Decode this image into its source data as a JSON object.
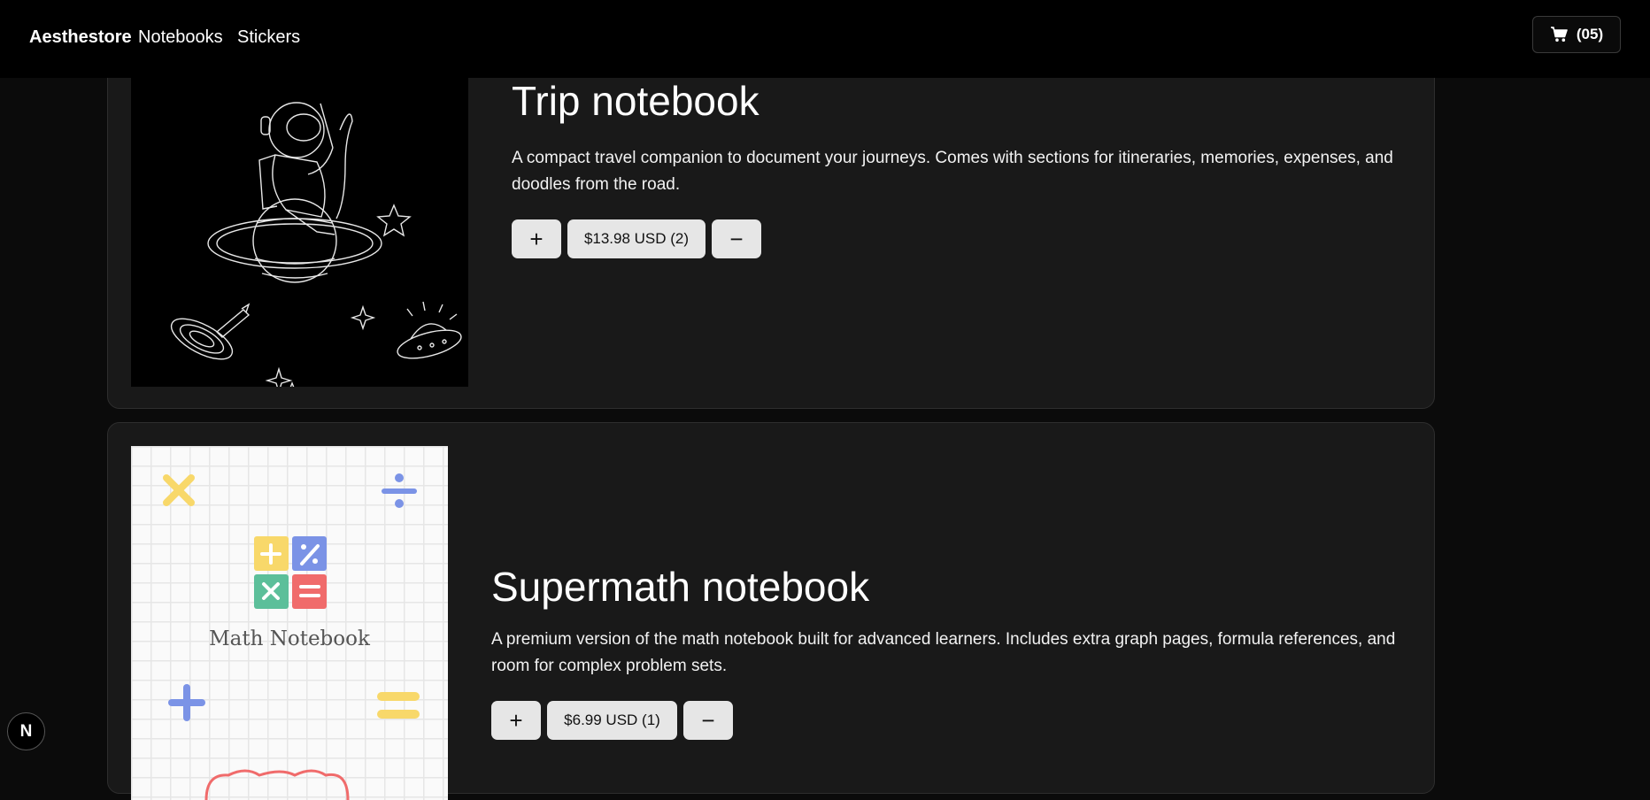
{
  "header": {
    "brand": "Aesthestore",
    "nav": [
      "Notebooks",
      "Stickers"
    ],
    "cart_count": "(05)",
    "cart_icon": "cart-icon"
  },
  "products": [
    {
      "title": "Trip notebook",
      "description": "A compact travel companion to document your journeys. Comes with sections for itineraries, memories, expenses, and doodles from the road.",
      "add_label": "+",
      "price_label": "$13.98 USD (2)",
      "remove_label": "−",
      "image": "astronaut-fishing-on-planet-illustration"
    },
    {
      "title": "Supermath notebook",
      "description": "A premium version of the math notebook built for advanced learners. Includes extra graph pages, formula references, and room for complex problem sets.",
      "add_label": "+",
      "price_label": "$6.99 USD (1)",
      "remove_label": "−",
      "image": "math-notebook-cover",
      "image_text": "Math Notebook"
    }
  ],
  "dev_badge": "N",
  "colors": {
    "page_bg": "#0b0b0b",
    "header_bg": "#000000",
    "card_bg": "#191919",
    "button_bg": "#e6e6e6"
  }
}
